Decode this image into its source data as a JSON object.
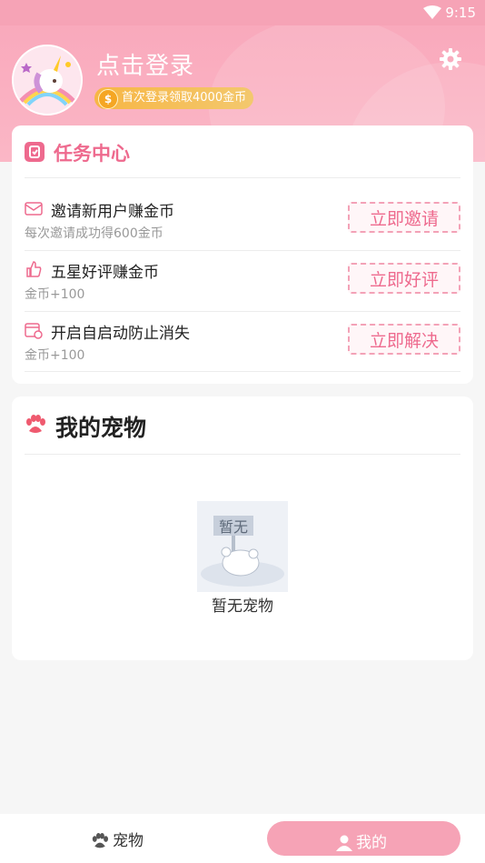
{
  "status_bar": {
    "time": "9:15"
  },
  "header": {
    "login_text": "点击登录",
    "coin_badge_text": "首次登录领取4000金币",
    "coin_symbol": "$"
  },
  "task_center": {
    "title": "任务中心",
    "tasks": [
      {
        "title": "邀请新用户赚金币",
        "subtitle": "每次邀请成功得600金币",
        "button": "立即邀请"
      },
      {
        "title": "五星好评赚金币",
        "subtitle": "金币+100",
        "button": "立即好评"
      },
      {
        "title": "开启自启动防止消失",
        "subtitle": "金币+100",
        "button": "立即解决"
      }
    ]
  },
  "my_pets": {
    "title": "我的宠物",
    "empty_image_text": "暂无",
    "empty_text": "暂无宠物"
  },
  "tabbar": {
    "pet": "宠物",
    "mine": "我的"
  },
  "colors": {
    "pink": "#f6a3b6",
    "accent": "#ee6a8e",
    "gold": "#f5a623"
  }
}
